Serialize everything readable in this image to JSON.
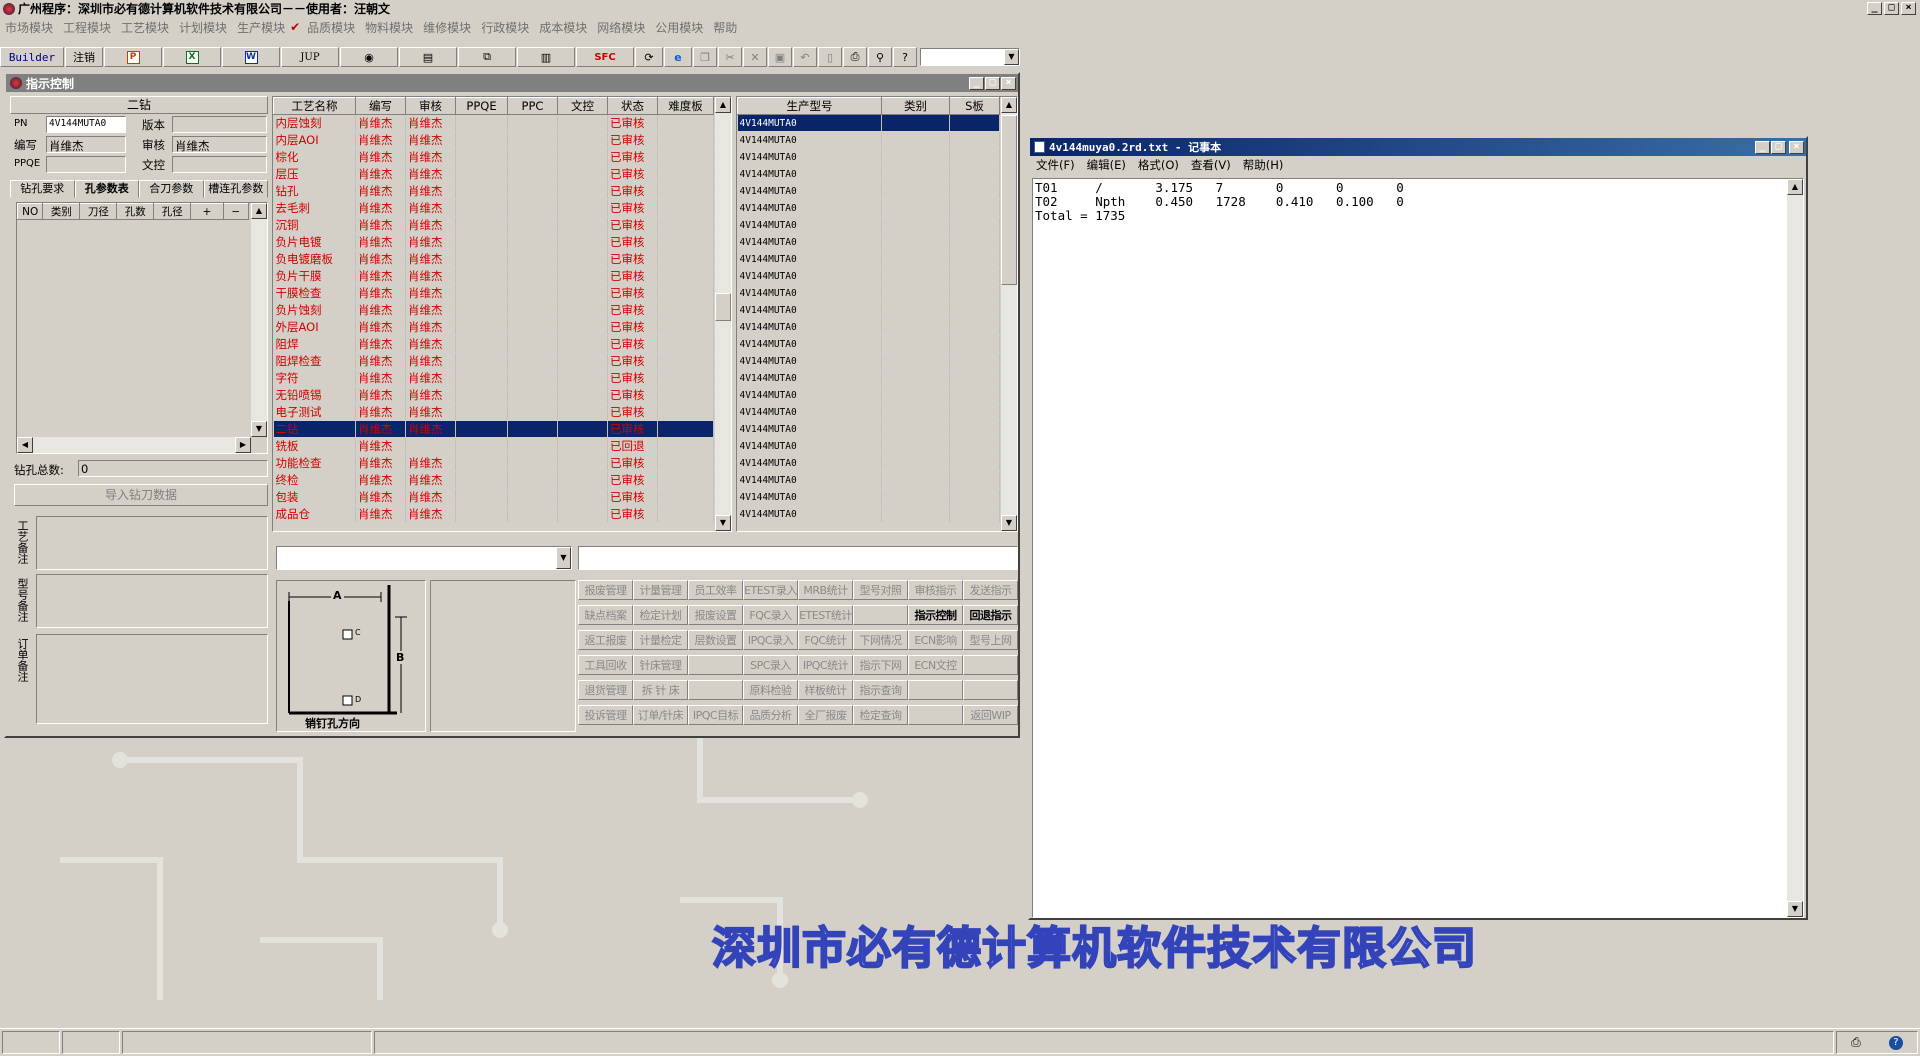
{
  "app": {
    "title": "广州程序：深圳市必有德计算机软件技术有限公司－－使用者：汪朝文",
    "menus": [
      "市场模块",
      "工程模块",
      "工艺模块",
      "计划模块",
      "生产模块",
      "品质模块",
      "物料模块",
      "维修模块",
      "行政模块",
      "成本模块",
      "网络模块",
      "公用模块",
      "帮助"
    ],
    "watermark": "深圳市必有德计算机软件技术有限公司"
  },
  "toolbar": {
    "builder": "Builder",
    "logout": "注销",
    "jup": "JUP",
    "spc": "SFC",
    "icons": [
      "powerpoint-icon",
      "excel-icon",
      "word-icon",
      "jup-button",
      "eye-icon",
      "book-icon",
      "network-icon",
      "printer-icon",
      "sfc-button",
      "refresh-icon",
      "ie-icon",
      "copy-icon",
      "cut-icon",
      "delete-icon",
      "save-icon",
      "undo-icon",
      "new-icon",
      "print-icon",
      "find-icon",
      "help-icon"
    ],
    "combo_value": ""
  },
  "inner": {
    "title": "指示控制",
    "left": {
      "section_title": "二钻",
      "pn_label": "PN",
      "pn_value": "4V144MUTA0",
      "version_label": "版本",
      "version_value": "",
      "author_label": "编写",
      "author_value": "肖维杰",
      "review_label": "审核",
      "review_value": "肖维杰",
      "ppqe_label": "PPQE",
      "ppqe_value": "",
      "control_label": "文控",
      "control_value": "",
      "tabs": [
        "钻孔要求",
        "孔参数表",
        "合刀参数",
        "槽连孔参数"
      ],
      "grid_headers": [
        "NO",
        "类别",
        "刀径",
        "孔数",
        "孔径",
        "+",
        "−"
      ],
      "total_label": "钻孔总数:",
      "total_value": "0",
      "import_button": "导入钻刀数据",
      "notes": [
        "工艺备注",
        "型号备注",
        "订单备注"
      ]
    },
    "process_table": {
      "headers": [
        "工艺名称",
        "编写",
        "审核",
        "PPQE",
        "PPC",
        "文控",
        "状态",
        "难度板"
      ],
      "rows": [
        [
          "内层蚀刻",
          "肖维杰",
          "肖维杰",
          "",
          "",
          "",
          "已审核",
          ""
        ],
        [
          "内层AOI",
          "肖维杰",
          "肖维杰",
          "",
          "",
          "",
          "已审核",
          ""
        ],
        [
          "棕化",
          "肖维杰",
          "肖维杰",
          "",
          "",
          "",
          "已审核",
          ""
        ],
        [
          "层压",
          "肖维杰",
          "肖维杰",
          "",
          "",
          "",
          "已审核",
          ""
        ],
        [
          "钻孔",
          "肖维杰",
          "肖维杰",
          "",
          "",
          "",
          "已审核",
          ""
        ],
        [
          "去毛刺",
          "肖维杰",
          "肖维杰",
          "",
          "",
          "",
          "已审核",
          ""
        ],
        [
          "沉铜",
          "肖维杰",
          "肖维杰",
          "",
          "",
          "",
          "已审核",
          ""
        ],
        [
          "负片电镀",
          "肖维杰",
          "肖维杰",
          "",
          "",
          "",
          "已审核",
          ""
        ],
        [
          "负电镀磨板",
          "肖维杰",
          "肖维杰",
          "",
          "",
          "",
          "已审核",
          ""
        ],
        [
          "负片干膜",
          "肖维杰",
          "肖维杰",
          "",
          "",
          "",
          "已审核",
          ""
        ],
        [
          "干膜检查",
          "肖维杰",
          "肖维杰",
          "",
          "",
          "",
          "已审核",
          ""
        ],
        [
          "负片蚀刻",
          "肖维杰",
          "肖维杰",
          "",
          "",
          "",
          "已审核",
          ""
        ],
        [
          "外层AOI",
          "肖维杰",
          "肖维杰",
          "",
          "",
          "",
          "已审核",
          ""
        ],
        [
          "阻焊",
          "肖维杰",
          "肖维杰",
          "",
          "",
          "",
          "已审核",
          ""
        ],
        [
          "阻焊检查",
          "肖维杰",
          "肖维杰",
          "",
          "",
          "",
          "已审核",
          ""
        ],
        [
          "字符",
          "肖维杰",
          "肖维杰",
          "",
          "",
          "",
          "已审核",
          ""
        ],
        [
          "无铅喷锡",
          "肖维杰",
          "肖维杰",
          "",
          "",
          "",
          "已审核",
          ""
        ],
        [
          "电子测试",
          "肖维杰",
          "肖维杰",
          "",
          "",
          "",
          "已审核",
          ""
        ],
        [
          "二钻",
          "肖维杰",
          "肖维杰",
          "",
          "",
          "",
          "已审核",
          ""
        ],
        [
          "铣板",
          "肖维杰",
          "",
          "",
          "",
          "",
          "已回退",
          ""
        ],
        [
          "功能检查",
          "肖维杰",
          "肖维杰",
          "",
          "",
          "",
          "已审核",
          ""
        ],
        [
          "终检",
          "肖维杰",
          "肖维杰",
          "",
          "",
          "",
          "已审核",
          ""
        ],
        [
          "包装",
          "肖维杰",
          "肖维杰",
          "",
          "",
          "",
          "已审核",
          ""
        ],
        [
          "成品仓",
          "肖维杰",
          "肖维杰",
          "",
          "",
          "",
          "已审核",
          ""
        ]
      ],
      "selected_index": 18
    },
    "model_table": {
      "headers": [
        "生产型号",
        "类别",
        "S板"
      ],
      "rows": [
        "4V144MUTA0",
        "4V144MUTA0",
        "4V144MUTA0",
        "4V144MUTA0",
        "4V144MUTA0",
        "4V144MUTA0",
        "4V144MUTA0",
        "4V144MUTA0",
        "4V144MUTA0",
        "4V144MUTA0",
        "4V144MUTA0",
        "4V144MUTA0",
        "4V144MUTA0",
        "4V144MUTA0",
        "4V144MUTA0",
        "4V144MUTA0",
        "4V144MUTA0",
        "4V144MUTA0",
        "4V144MUTA0",
        "4V144MUTA0",
        "4V144MUTA0",
        "4V144MUTA0",
        "4V144MUTA0",
        "4V144MUTA0"
      ],
      "selected_index": 0
    },
    "diagram": {
      "a_label": "A",
      "b_label": "B",
      "c_label": "C",
      "d_label": "D",
      "caption": "销钉孔方向"
    },
    "function_buttons": [
      [
        "报废管理",
        "计量管理",
        "员工效率",
        "ETEST录入",
        "MRB统计",
        "型号对照",
        "审核指示",
        "发送指示"
      ],
      [
        "缺点档案",
        "检定计划",
        "报废设置",
        "FQC录入",
        "ETEST统计",
        "",
        "指示控制",
        "回退指示"
      ],
      [
        "返工报废",
        "计量检定",
        "层数设置",
        "IPQC录入",
        "FQC统计",
        "下网情况",
        "ECN影响",
        "型号上网"
      ],
      [
        "工具回收",
        "针床管理",
        "",
        "SPC录入",
        "IPQC统计",
        "指示下网",
        "ECN文控",
        ""
      ],
      [
        "退货管理",
        "拆 针 床",
        "",
        "原料检验",
        "样板统计",
        "指示查询",
        "",
        ""
      ],
      [
        "投诉管理",
        "订单/针床",
        "IPQC目标",
        "品质分析",
        "全厂报废",
        "检定查询",
        "",
        "返回WIP"
      ]
    ],
    "active_buttons": [
      "指示控制",
      "回退指示"
    ]
  },
  "notepad": {
    "title": "4v144muya0.2rd.txt - 记事本",
    "menus": [
      "文件(F)",
      "编辑(E)",
      "格式(O)",
      "查看(V)",
      "帮助(H)"
    ],
    "content": "T01     /       3.175   7       0       0       0\nT02     Npth    0.450   1728    0.410   0.100   0\nTotal = 1735"
  },
  "statusbar": {
    "cells": [
      "",
      "",
      "",
      "",
      ""
    ]
  }
}
